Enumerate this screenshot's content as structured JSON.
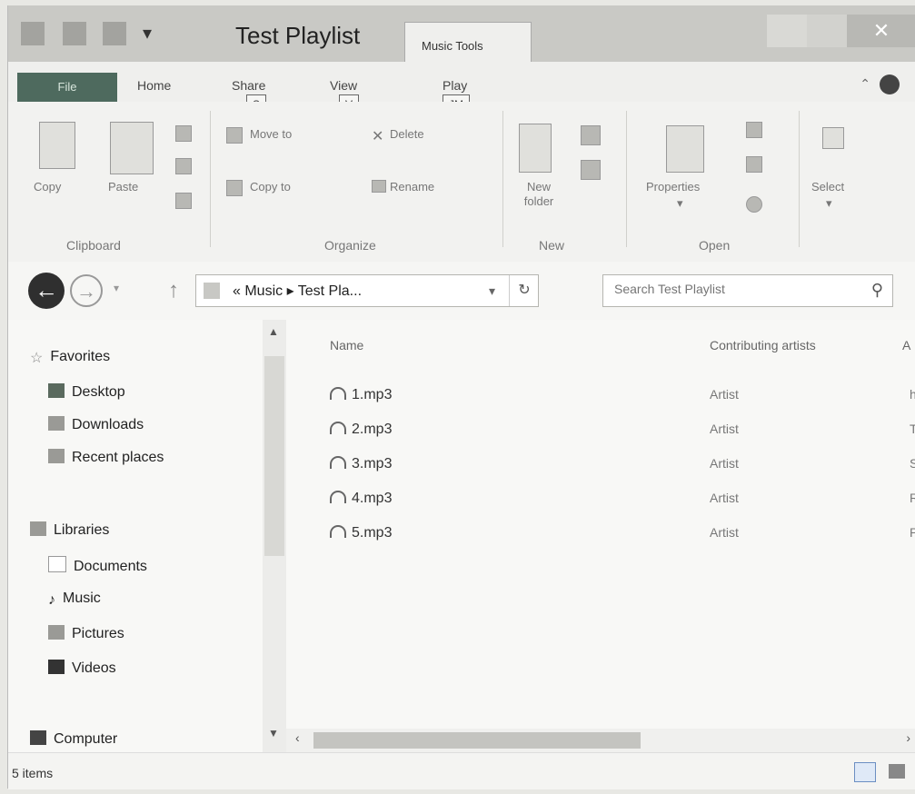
{
  "window": {
    "title": "Test Playlist",
    "context_tab": "Music Tools",
    "close_glyph": "✕"
  },
  "ribbon_tabs": {
    "file": "File",
    "home": "Home",
    "share": "Share",
    "share_key": "S",
    "view": "View",
    "view_key": "V",
    "play": "Play",
    "play_key": "JM"
  },
  "ribbon": {
    "copy": "Copy",
    "paste": "Paste",
    "clipboard": "Clipboard",
    "move_to": "Move to",
    "copy_to": "Copy to",
    "delete": "Delete",
    "rename": "Rename",
    "organize": "Organize",
    "new_folder": "New folder",
    "new": "New",
    "properties": "Properties",
    "open": "Open",
    "select": "Select"
  },
  "address": {
    "path": "« Music ▸ Test Pla...",
    "search_placeholder": "Search Test Playlist"
  },
  "nav": {
    "favorites": "Favorites",
    "desktop": "Desktop",
    "downloads": "Downloads",
    "recent": "Recent places",
    "libraries": "Libraries",
    "documents": "Documents",
    "music": "Music",
    "pictures": "Pictures",
    "videos": "Videos",
    "computer": "Computer"
  },
  "columns": {
    "name": "Name",
    "artists": "Contributing artists",
    "album": "A"
  },
  "files": [
    {
      "name": "1.mp3",
      "artist": "Artist",
      "album": "h"
    },
    {
      "name": "2.mp3",
      "artist": "Artist",
      "album": "T"
    },
    {
      "name": "3.mp3",
      "artist": "Artist",
      "album": "S"
    },
    {
      "name": "4.mp3",
      "artist": "Artist",
      "album": "R"
    },
    {
      "name": "5.mp3",
      "artist": "Artist",
      "album": "P"
    }
  ],
  "status": {
    "count": "5 items"
  }
}
